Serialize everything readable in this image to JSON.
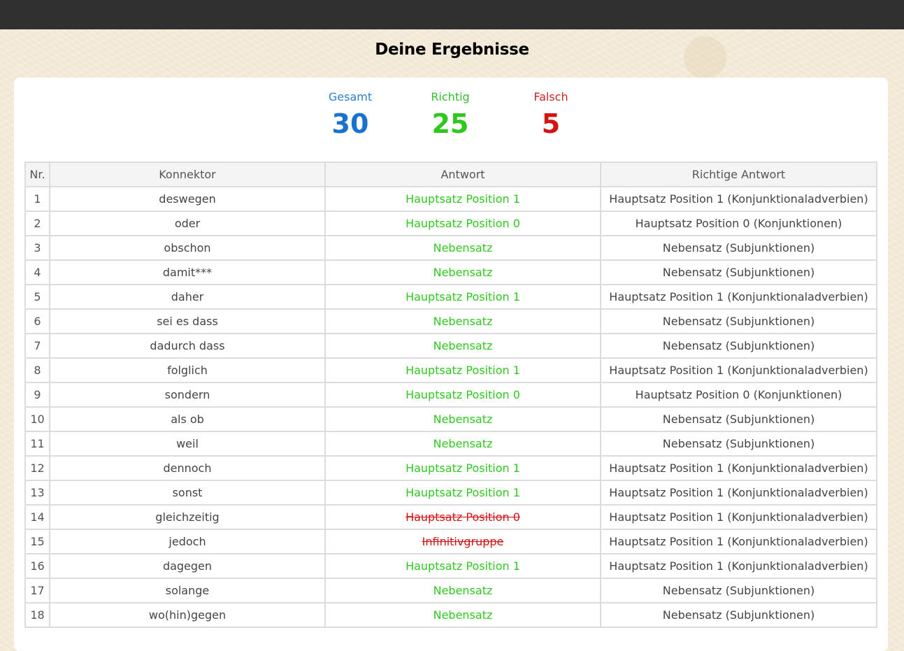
{
  "page": {
    "title": "Deine Ergebnisse"
  },
  "stats": {
    "total_label": "Gesamt",
    "total": "30",
    "correct_label": "Richtig",
    "correct": "25",
    "wrong_label": "Falsch",
    "wrong": "5"
  },
  "colors": {
    "total": "#1a72d0",
    "correct": "#2fc81e",
    "wrong": "#d41313",
    "topbar": "#303030"
  },
  "table": {
    "headers": [
      "Nr.",
      "Konnektor",
      "Antwort",
      "Richtige Antwort"
    ],
    "rows": [
      {
        "nr": "1",
        "konnektor": "deswegen",
        "antwort": "Hauptsatz Position 1",
        "richtig": "Hauptsatz Position 1 (Konjunktionaladverbien)",
        "correct": true
      },
      {
        "nr": "2",
        "konnektor": "oder",
        "antwort": "Hauptsatz Position 0",
        "richtig": "Hauptsatz Position 0 (Konjunktionen)",
        "correct": true
      },
      {
        "nr": "3",
        "konnektor": "obschon",
        "antwort": "Nebensatz",
        "richtig": "Nebensatz (Subjunktionen)",
        "correct": true
      },
      {
        "nr": "4",
        "konnektor": "damit***",
        "antwort": "Nebensatz",
        "richtig": "Nebensatz (Subjunktionen)",
        "correct": true
      },
      {
        "nr": "5",
        "konnektor": "daher",
        "antwort": "Hauptsatz Position 1",
        "richtig": "Hauptsatz Position 1 (Konjunktionaladverbien)",
        "correct": true
      },
      {
        "nr": "6",
        "konnektor": "sei es dass",
        "antwort": "Nebensatz",
        "richtig": "Nebensatz (Subjunktionen)",
        "correct": true
      },
      {
        "nr": "7",
        "konnektor": "dadurch dass",
        "antwort": "Nebensatz",
        "richtig": "Nebensatz (Subjunktionen)",
        "correct": true
      },
      {
        "nr": "8",
        "konnektor": "folglich",
        "antwort": "Hauptsatz Position 1",
        "richtig": "Hauptsatz Position 1 (Konjunktionaladverbien)",
        "correct": true
      },
      {
        "nr": "9",
        "konnektor": "sondern",
        "antwort": "Hauptsatz Position 0",
        "richtig": "Hauptsatz Position 0 (Konjunktionen)",
        "correct": true
      },
      {
        "nr": "10",
        "konnektor": "als ob",
        "antwort": "Nebensatz",
        "richtig": "Nebensatz (Subjunktionen)",
        "correct": true
      },
      {
        "nr": "11",
        "konnektor": "weil",
        "antwort": "Nebensatz",
        "richtig": "Nebensatz (Subjunktionen)",
        "correct": true
      },
      {
        "nr": "12",
        "konnektor": "dennoch",
        "antwort": "Hauptsatz Position 1",
        "richtig": "Hauptsatz Position 1 (Konjunktionaladverbien)",
        "correct": true
      },
      {
        "nr": "13",
        "konnektor": "sonst",
        "antwort": "Hauptsatz Position 1",
        "richtig": "Hauptsatz Position 1 (Konjunktionaladverbien)",
        "correct": true
      },
      {
        "nr": "14",
        "konnektor": "gleichzeitig",
        "antwort": "Hauptsatz Position 0",
        "richtig": "Hauptsatz Position 1 (Konjunktionaladverbien)",
        "correct": false
      },
      {
        "nr": "15",
        "konnektor": "jedoch",
        "antwort": "Infinitivgruppe",
        "richtig": "Hauptsatz Position 1 (Konjunktionaladverbien)",
        "correct": false
      },
      {
        "nr": "16",
        "konnektor": "dagegen",
        "antwort": "Hauptsatz Position 1",
        "richtig": "Hauptsatz Position 1 (Konjunktionaladverbien)",
        "correct": true
      },
      {
        "nr": "17",
        "konnektor": "solange",
        "antwort": "Nebensatz",
        "richtig": "Nebensatz (Subjunktionen)",
        "correct": true
      },
      {
        "nr": "18",
        "konnektor": "wo(hin)gegen",
        "antwort": "Nebensatz",
        "richtig": "Nebensatz (Subjunktionen)",
        "correct": true
      }
    ]
  }
}
